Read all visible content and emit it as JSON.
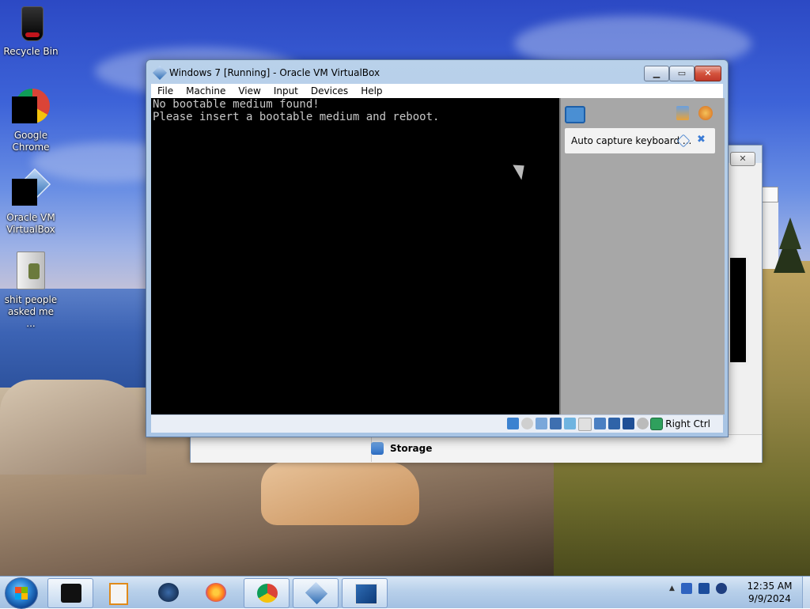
{
  "desktop": {
    "icons": [
      {
        "label": "Recycle Bin",
        "icon": "recycle-bin-icon"
      },
      {
        "label": "Google Chrome",
        "icon": "chrome-icon"
      },
      {
        "label": "Oracle VM VirtualBox",
        "icon": "virtualbox-icon"
      },
      {
        "label": "shit people asked me ...",
        "icon": "file-icon"
      }
    ]
  },
  "background_window": {
    "close_glyph": "✕",
    "section_label": "Storage"
  },
  "vm_window": {
    "title": "Windows 7 [Running] - Oracle VM VirtualBox",
    "menu": [
      "File",
      "Machine",
      "View",
      "Input",
      "Devices",
      "Help"
    ],
    "console_lines": [
      "No bootable medium found!",
      "Please insert a bootable medium and reboot."
    ],
    "notice_text": "Auto capture keyboard ...",
    "host_key": "Right Ctrl",
    "caption_buttons": {
      "minimize": "▁",
      "maximize": "▭",
      "close": "✕"
    }
  },
  "taskbar": {
    "apps": [
      "black-app-icon",
      "media-player-icon",
      "globe-icon",
      "firefox-icon",
      "chrome-icon",
      "virtualbox-icon",
      "windows7-vm-icon"
    ],
    "tray_arrow": "▲",
    "time": "12:35 AM",
    "date": "9/9/2024"
  },
  "colors": {
    "console_text": "#c8c8c8",
    "titlebar": "#b9d1ea",
    "close_button": "#d4533d",
    "taskbar": "#b8d0ea"
  }
}
